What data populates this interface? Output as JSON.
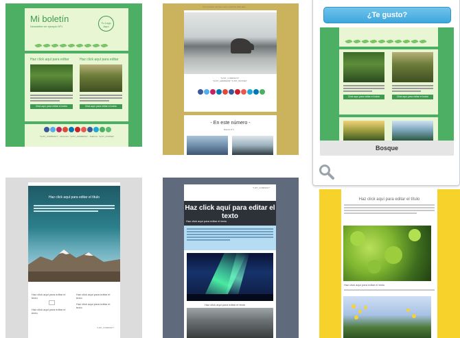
{
  "colors": {
    "green_bg": "#4caf63",
    "gold_bg": "#cbb35e",
    "yellow_bg": "#f7d22a",
    "slate_bg": "#5f6a7c",
    "gray_bg": "#dcdcdc",
    "button_blue": "#3ea7dc"
  },
  "templates": {
    "green": {
      "title": "Mi boletín",
      "subtitle": "Newsletter de ejemplo Nº1",
      "logo": "Tu Logo Aquí",
      "col_heading": "Haz click aquí para editar",
      "button": "Click aquí para editar el botón",
      "merge_tags": "*|LIST_COMPANY|*  -  Dirección: *|LIST_ADDRESS|*  -  Teléfono: *|LIST_PHONE|*"
    },
    "coast": {
      "header_note": "Si no puedes ver bien este email haz click aquí",
      "merge_tags": "*|LIST_COMPANY|*\n*|LIST_ADDRESS|* *|LIST_PHONE|*",
      "in_this_issue": "- En este número -",
      "issue_no": "Boletín Nº1"
    },
    "mountain": {
      "title": "Haz click aquí para editar el título",
      "col_left": "Haz click aquí para editar el texto",
      "col_right": "Haz click aquí para editar el texto",
      "footer": "*LIST_COMPANY*"
    },
    "aurora": {
      "headline": "Haz click aquí para editar el texto",
      "subline": "Haz click aquí para editar el texto",
      "caption": "Haz click aquí para editar el texto",
      "merge_tags": "*LIST_COMPANY*"
    },
    "yellow": {
      "title": "Haz click aquí para editar el título",
      "caption": "Haz click aquí para editar el texto"
    }
  },
  "popup": {
    "like_button": "¿Te gusto?",
    "template_name": "Bosque"
  }
}
